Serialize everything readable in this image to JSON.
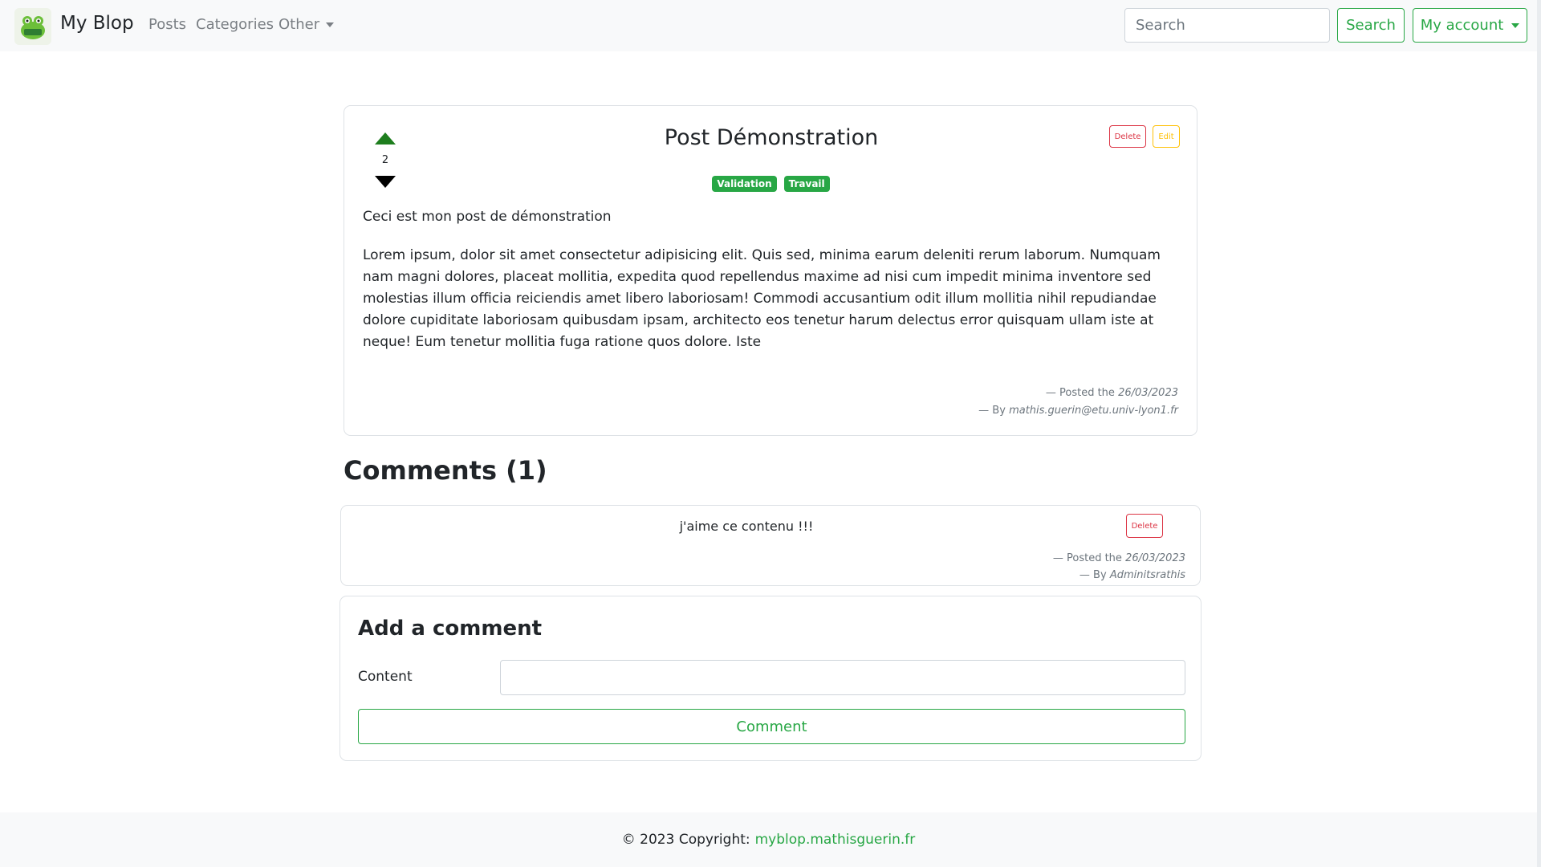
{
  "brand": {
    "name": "My Blop",
    "logo_icon": "frog-logo-icon"
  },
  "nav": {
    "links": [
      "Posts",
      "Categories",
      "Other"
    ],
    "search_placeholder": "Search",
    "search_button": "Search",
    "account_button": "My account"
  },
  "post": {
    "votes": "2",
    "title": "Post Démonstration",
    "tags": [
      "Validation",
      "Travail"
    ],
    "delete_label": "Delete",
    "edit_label": "Edit",
    "summary": "Ceci est mon post de démonstration",
    "body": "Lorem ipsum, dolor sit amet consectetur adipisicing elit. Quis sed, minima earum deleniti rerum laborum. Numquam nam magni dolores, placeat mollitia, expedita quod repellendus maxime ad nisi cum impedit minima inventore sed molestias illum officia reiciendis amet libero laboriosam! Commodi accusantium odit illum mollitia nihil repudiandae dolore cupiditate laboriosam quibusdam ipsam, architecto eos tenetur harum delectus error quisquam ullam iste at neque! Eum tenetur mollitia fuga ratione quos dolore. Iste",
    "posted_prefix": "— Posted the",
    "posted_date": "26/03/2023",
    "by_prefix": "— By",
    "author": "mathis.guerin@etu.univ-lyon1.fr"
  },
  "comments": {
    "heading": "Comments (1)",
    "items": [
      {
        "text": "j'aime ce contenu !!!",
        "delete_label": "Delete",
        "posted_prefix": "— Posted the",
        "posted_date": "26/03/2023",
        "by_prefix": "— By",
        "author": "Adminitsrathis"
      }
    ]
  },
  "add_comment": {
    "title": "Add a comment",
    "content_label": "Content",
    "content_value": "",
    "submit_label": "Comment"
  },
  "footer": {
    "copyright": "© 2023 Copyright:",
    "link_text": "myblop.mathisguerin.fr"
  },
  "colors": {
    "accent": "#28a745",
    "danger": "#dc3545",
    "warning": "#ffc107",
    "upvote": "#1e7e1e"
  }
}
